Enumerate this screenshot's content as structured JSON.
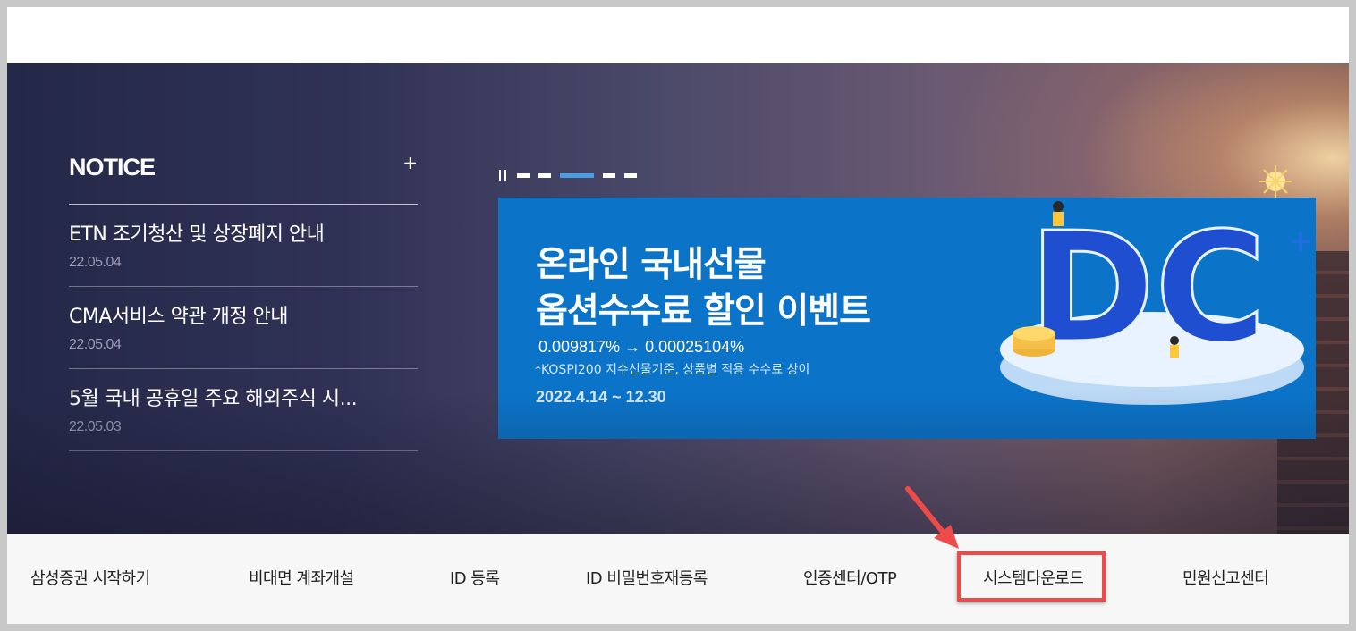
{
  "notice": {
    "title": "NOTICE",
    "more": "+",
    "items": [
      {
        "title": "ETN 조기청산 및 상장폐지 안내",
        "date": "22.05.04"
      },
      {
        "title": "CMA서비스 약관 개정 안내",
        "date": "22.05.04"
      },
      {
        "title": "5월 국내 공휴일 주요 해외주식 시...",
        "date": "22.05.03"
      }
    ]
  },
  "banner": {
    "line1": "온라인 국내선물",
    "line2": "옵션수수료 할인 이벤트",
    "rate": "0.009817% → 0.00025104%",
    "note": "*KOSPI200 지수선물기준, 상품별 적용 수수료 상이",
    "period": "2022.4.14 ~ 12.30",
    "art_text": "DC",
    "art_plus": "+",
    "pager_active_index": 2
  },
  "quickbar": {
    "items": [
      "삼성증권 시작하기",
      "비대면 계좌개설",
      "ID 등록",
      "ID 비밀번호재등록",
      "인증센터/OTP",
      "시스템다운로드",
      "민원신고센터"
    ],
    "highlighted": "시스템다운로드"
  },
  "colors": {
    "banner_bg": "#0b74c9",
    "highlight": "#ef4a4a",
    "pager_active": "#4a9ee0"
  },
  "icons": {
    "notice_more": "plus-icon",
    "pager_pause": "pause-icon",
    "annotation": "arrow-icon"
  }
}
